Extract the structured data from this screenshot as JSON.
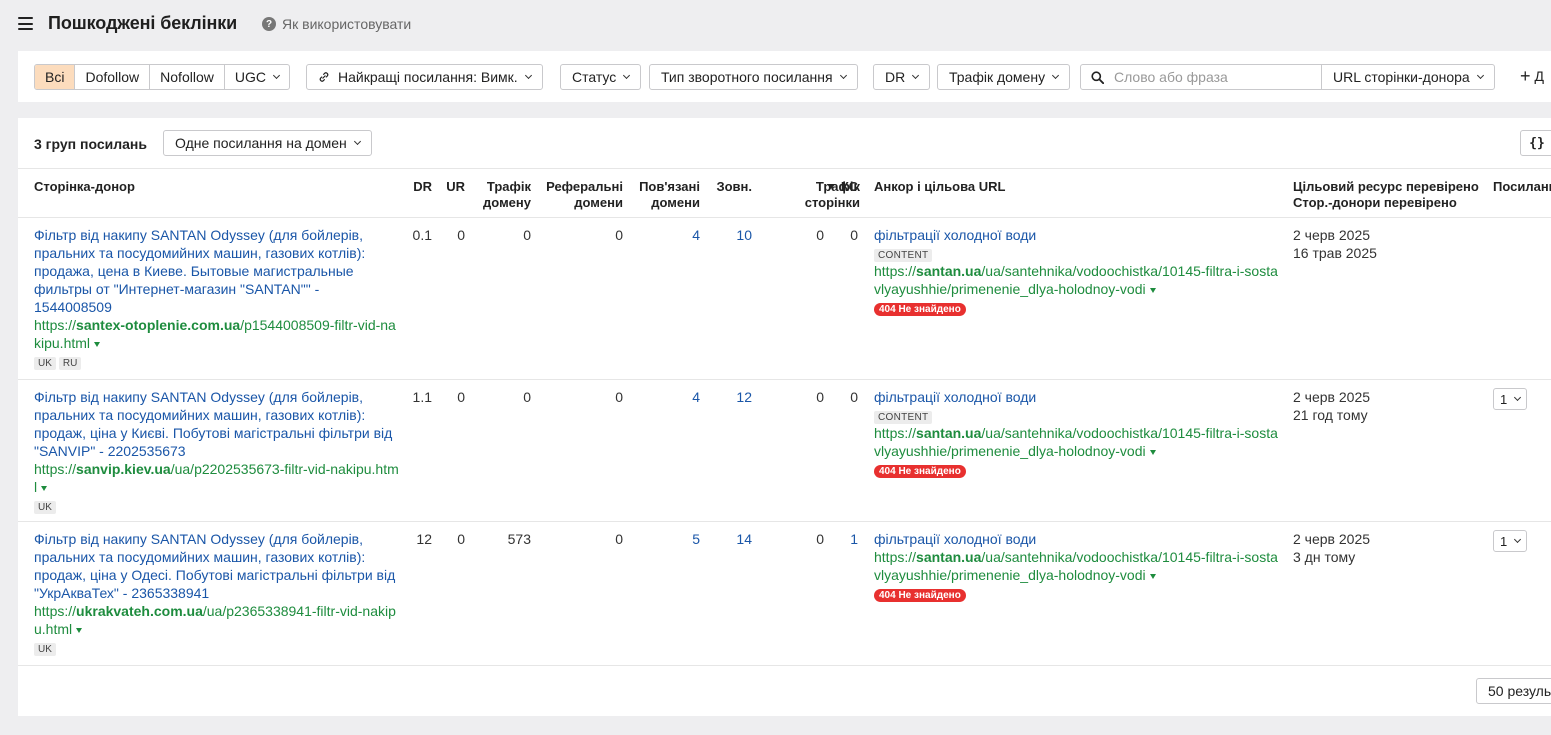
{
  "header": {
    "title": "Пошкоджені беклінки",
    "help_label": "Як використовувати"
  },
  "filters": {
    "link_types": [
      "Всі",
      "Dofollow",
      "Nofollow",
      "UGC"
    ],
    "best_links_label": "Найкращі посилання: Вимк.",
    "status_label": "Статус",
    "backlink_type_label": "Тип зворотного посилання",
    "dr_label": "DR",
    "domain_traffic_label": "Трафік домену",
    "search_placeholder": "Слово або фраза",
    "url_select_label": "URL сторінки-донора",
    "add_filter_label": "Д"
  },
  "summary": {
    "groups_label": "3 груп посилань",
    "grouping_label": "Одне посилання на домен",
    "json_label": "{}"
  },
  "columns": {
    "donor": "Сторінка-донор",
    "dr": "DR",
    "ur": "UR",
    "domain_traffic": "Трафік домену",
    "ref_domains": "Реферальні домени",
    "linked_domains": "Пов'язані домени",
    "external": "Зовн.",
    "page_traffic": "Трафік сторінки",
    "ks": "КС",
    "anchor": "Анкор і цільова URL",
    "target_checked": "Цільовий ресурс перевірено",
    "donor_checked": "Стор.-донори перевірено",
    "links": "Посилань"
  },
  "rows": [
    {
      "title": "Фільтр від накипу SANTAN Odyssey (для бойлерів, пральних та посудомийних машин, газових котлів): продажа, цена в Киеве. Бытовые магистральные фильтры от \"Интернет-магазин \"SANTAN\"\" - 1544008509",
      "url_prefix": "https://",
      "url_domain": "santex-otoplenie.com.ua",
      "url_path": "/p1544008509-filtr-vid-nakipu.html",
      "langs": [
        "UK",
        "RU"
      ],
      "dr": "0.1",
      "ur": "0",
      "domain_traffic": "0",
      "ref_domains": "0",
      "linked_domains": "4",
      "external": "10",
      "page_traffic": "0",
      "ks": "0",
      "anchor": "фільтрації холодної води",
      "tag": "CONTENT",
      "target_prefix": "https://",
      "target_domain": "santan.ua",
      "target_path": "/ua/santehnika/vodoochistka/10145-filtra-i-sostavlyayushhie/primenenie_dlya-holodnoy-vodi",
      "error": "404 Не знайдено",
      "target_checked": "2 черв 2025",
      "donor_checked": "16 трав 2025",
      "links": ""
    },
    {
      "title": "Фільтр від накипу SANTAN Odyssey (для бойлерів, пральних та посудомийних машин, газових котлів): продаж, ціна у Києві. Побутові магістральні фільтри від \"SANVIP\" - 2202535673",
      "url_prefix": "https://",
      "url_domain": "sanvip.kiev.ua",
      "url_path": "/ua/p2202535673-filtr-vid-nakipu.html",
      "langs": [
        "UK"
      ],
      "dr": "1.1",
      "ur": "0",
      "domain_traffic": "0",
      "ref_domains": "0",
      "linked_domains": "4",
      "external": "12",
      "page_traffic": "0",
      "ks": "0",
      "anchor": "фільтрації холодної води",
      "tag": "CONTENT",
      "target_prefix": "https://",
      "target_domain": "santan.ua",
      "target_path": "/ua/santehnika/vodoochistka/10145-filtra-i-sostavlyayushhie/primenenie_dlya-holodnoy-vodi",
      "error": "404 Не знайдено",
      "target_checked": "2 черв 2025",
      "donor_checked": "21 год тому",
      "links": "1"
    },
    {
      "title": "Фільтр від накипу SANTAN Odyssey (для бойлерів, пральних та посудомийних машин, газових котлів): продаж, ціна у Одесі. Побутові магістральні фільтри від \"УкрАкваТех\" - 2365338941",
      "url_prefix": "https://",
      "url_domain": "ukrakvateh.com.ua",
      "url_path": "/ua/p2365338941-filtr-vid-nakipu.html",
      "langs": [
        "UK"
      ],
      "dr": "12",
      "ur": "0",
      "domain_traffic": "573",
      "ref_domains": "0",
      "linked_domains": "5",
      "external": "14",
      "page_traffic": "0",
      "ks": "1",
      "anchor": "фільтрації холодної води",
      "tag": "",
      "target_prefix": "https://",
      "target_domain": "santan.ua",
      "target_path": "/ua/santehnika/vodoochistka/10145-filtra-i-sostavlyayushhie/primenenie_dlya-holodnoy-vodi",
      "error": "404 Не знайдено",
      "target_checked": "2 черв 2025",
      "donor_checked": "3 дн тому",
      "links": "1"
    }
  ],
  "footer": {
    "per_page_label": "50 резуль"
  },
  "colors": {
    "accent": "#fcdcbd",
    "link": "#1a56a8",
    "url": "#1e8c3e",
    "error": "#e8302f"
  }
}
